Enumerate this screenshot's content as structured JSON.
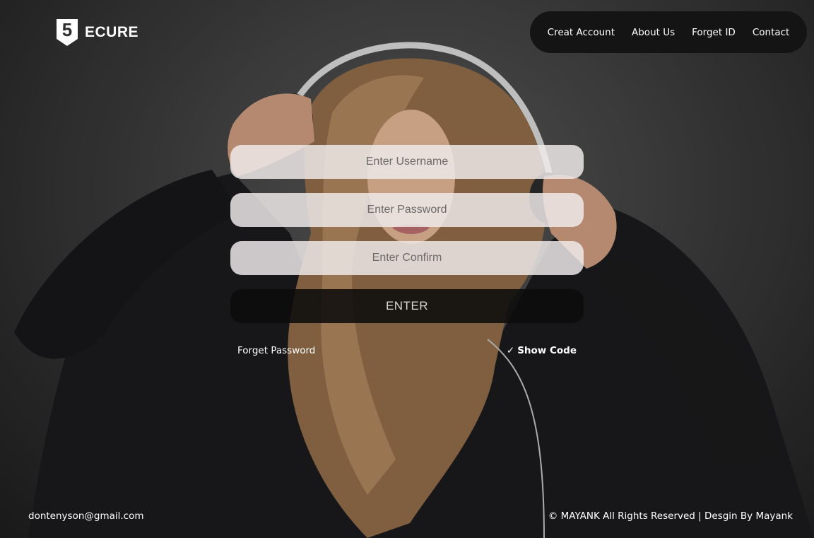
{
  "brand": {
    "logo_glyph": "5",
    "name": "ECURE"
  },
  "nav": {
    "items": [
      {
        "label": "Creat Account"
      },
      {
        "label": "About Us"
      },
      {
        "label": "Forget ID"
      },
      {
        "label": "Contact"
      }
    ]
  },
  "form": {
    "username_placeholder": "Enter Username",
    "password_placeholder": "Enter Password",
    "confirm_placeholder": "Enter Confirm",
    "enter_label": "ENTER",
    "forget_password_label": "Forget Password",
    "show_code_check": "✓",
    "show_code_label": "Show Code"
  },
  "footer": {
    "email": "dontenyson@gmail.com",
    "copyright": "© MAYANK All Rights Reserved | Desgin By Mayank"
  },
  "colors": {
    "nav_background": "#141414",
    "input_background": "#f0ebeb",
    "button_background": "#0c0c0c",
    "page_background": "#3d3d3d"
  }
}
